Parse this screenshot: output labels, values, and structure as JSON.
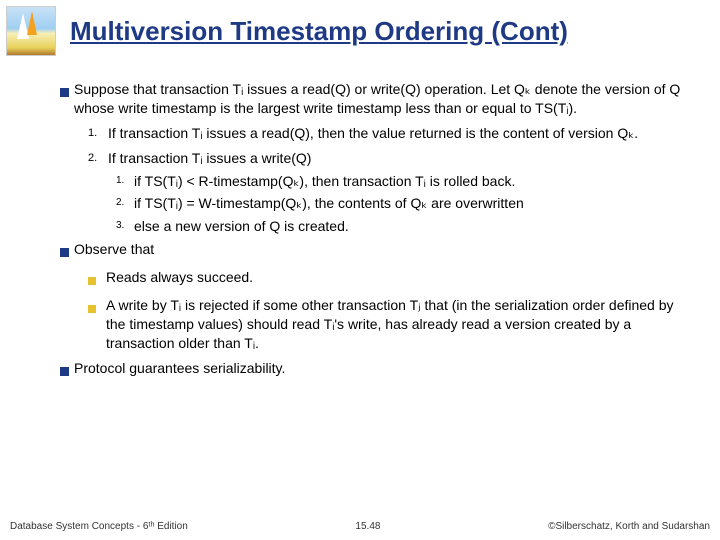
{
  "title": "Multiversion Timestamp Ordering (Cont)",
  "bullets": {
    "suppose": "Suppose that transaction Tᵢ issues a read(Q) or write(Q) operation.  Let Qₖ denote the version of Q whose write timestamp is the largest write timestamp less than or equal to TS(Tᵢ).",
    "rule1": "If transaction Tᵢ issues a read(Q), then the value returned is the content of version Qₖ.",
    "rule2": "If transaction Tᵢ issues a  write(Q)",
    "rule2a": "if TS(Tᵢ) < R-timestamp(Qₖ), then transaction Tᵢ is rolled back.",
    "rule2b": "if TS(Tᵢ) = W-timestamp(Qₖ), the contents of Qₖ are overwritten",
    "rule2c": "else a new version of Q is created.",
    "observe": "Observe that",
    "obs1": "Reads always succeed.",
    "obs2": "A write by Tᵢ is rejected if some other transaction Tⱼ that (in the serialization order defined by the timestamp values) should read Tᵢ's write, has already read a version created by a transaction older than Tᵢ.",
    "protocol": "Protocol guarantees serializability."
  },
  "nums": {
    "one": "1.",
    "two": "2.",
    "three": "3."
  },
  "footer": {
    "left": "Database System Concepts - 6ᵗʰ Edition",
    "center": "15.48",
    "right": "©Silberschatz, Korth and Sudarshan"
  }
}
